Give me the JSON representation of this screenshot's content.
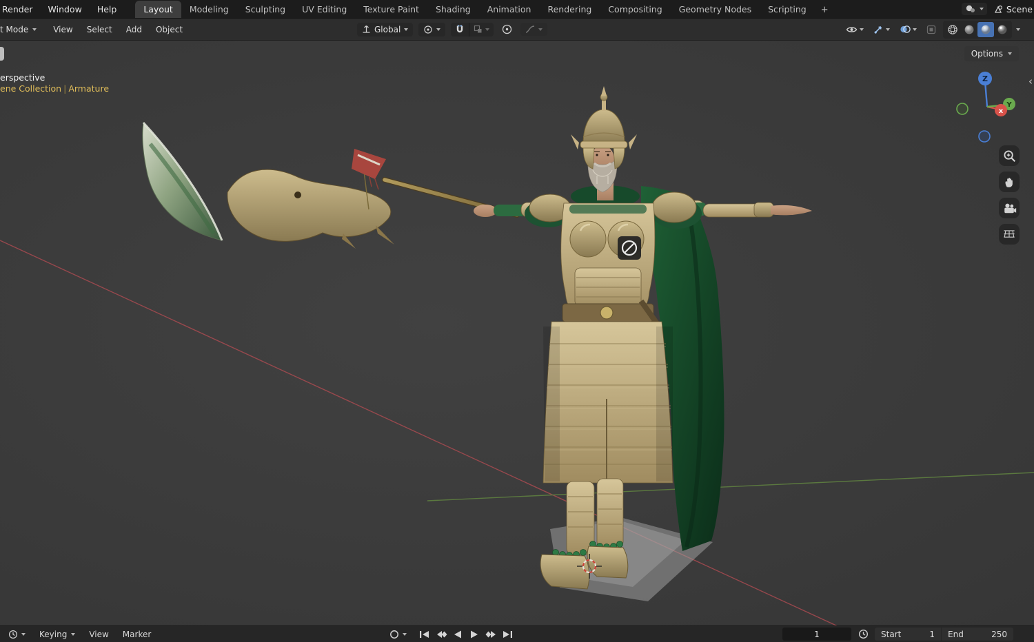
{
  "topbar": {
    "menus": [
      {
        "label": "Render"
      },
      {
        "label": "Window"
      },
      {
        "label": "Help"
      }
    ],
    "tabs": [
      {
        "label": "Layout",
        "active": true
      },
      {
        "label": "Modeling"
      },
      {
        "label": "Sculpting"
      },
      {
        "label": "UV Editing"
      },
      {
        "label": "Texture Paint"
      },
      {
        "label": "Shading"
      },
      {
        "label": "Animation"
      },
      {
        "label": "Rendering"
      },
      {
        "label": "Compositing"
      },
      {
        "label": "Geometry Nodes"
      },
      {
        "label": "Scripting"
      }
    ],
    "add_workspace": "+",
    "scene_label": "Scene"
  },
  "viewport_header": {
    "mode_label": "t Mode",
    "menus": [
      {
        "label": "View"
      },
      {
        "label": "Select"
      },
      {
        "label": "Add"
      },
      {
        "label": "Object"
      }
    ],
    "orientation_label": "Global",
    "options_label": "Options"
  },
  "viewport_overlay": {
    "perspective_text": "erspective",
    "collection_text": "ene Collection",
    "separator": "|",
    "object_text": "Armature"
  },
  "nav_gizmo": {
    "x_label": "x",
    "y_label": "Y",
    "z_label": "Z"
  },
  "timeline": {
    "keying_label": "Keying",
    "menus": [
      {
        "label": "View"
      },
      {
        "label": "Marker"
      }
    ],
    "current_frame": "1",
    "start_label": "Start",
    "start_value": "1",
    "end_label": "End",
    "end_value": "250"
  },
  "icons": {
    "chevron_down": "css-triangle",
    "orientation_axes": "svg-axes",
    "pivot_point": "svg-circle-dot",
    "snap_magnet": "svg-horseshoe",
    "snap_target": "svg-squares",
    "proportional_editing": "svg-ring-dot",
    "falloff_curve": "svg-curve",
    "visibility_eye": "svg-eye",
    "gizmos_arrow": "svg-arrow",
    "overlays_circles": "svg-two-circles",
    "xray": "svg-square",
    "shading_wireframe": "svg-wire-sphere",
    "shading_solid": "svg-sphere",
    "shading_material": "svg-sphere-blue",
    "shading_rendered": "svg-sphere-shine",
    "zoom_tool": "svg-magnifier",
    "pan_hand": "svg-hand",
    "camera_view": "svg-camera",
    "ortho_grid": "svg-grid",
    "prohibit_cursor": "circle-slash",
    "auto_key_record": "ring",
    "preview_range_clock": "svg-clock",
    "scene_selector": "svg-scene"
  },
  "colors": {
    "accent_blue": "#4772b3",
    "overlay_yellow": "#e0bd5a",
    "axis_x_red": "#a84a50",
    "axis_y_green": "#5f8040",
    "cape_green": "#1b5a33",
    "armor_gold": "#b3a070",
    "viewport_bg": "#3b3b3b"
  }
}
